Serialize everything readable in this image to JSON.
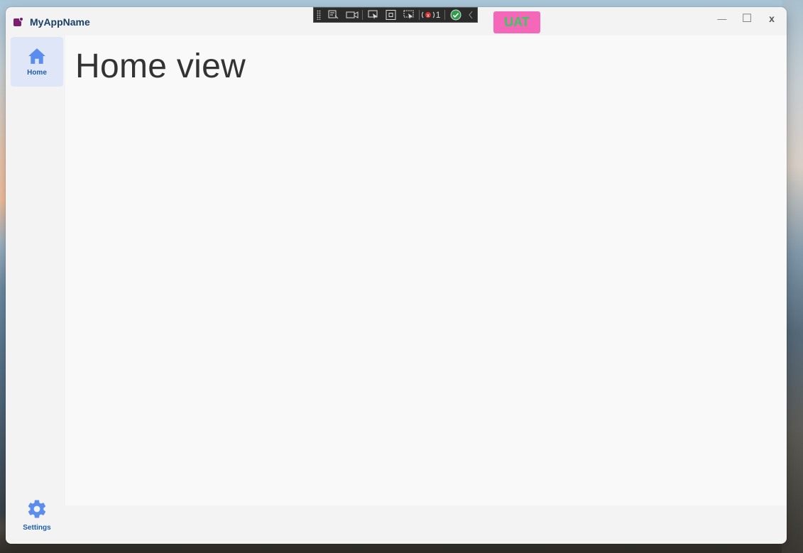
{
  "window": {
    "app_title": "MyAppName",
    "minimize_glyph": "—",
    "maximize_glyph": "☐",
    "close_glyph": "x"
  },
  "debug_toolbar": {
    "icons": [
      "grip-icon",
      "live-visual-tree-icon",
      "video-icon",
      "select-element-icon",
      "display-layout-adorners-icon",
      "track-focused-element-icon",
      "binding-failures-icon",
      "accessibility-check-icon",
      "collapse-chevron-icon"
    ],
    "binding_failure_count": "1"
  },
  "env_badge": {
    "label": "UAT",
    "background": "#f467b9",
    "text_color": "#38c95f"
  },
  "nav": {
    "items": [
      {
        "label": "Home",
        "icon": "home-icon",
        "selected": true
      },
      {
        "label": "Settings",
        "icon": "gear-icon",
        "selected": false
      }
    ]
  },
  "main": {
    "title": "Home view"
  },
  "colors": {
    "accent": "#1f5fa8",
    "nav_icon": "#5b8def",
    "selected_bg": "#dfe6f7",
    "content_bg": "#f9f9f9"
  }
}
